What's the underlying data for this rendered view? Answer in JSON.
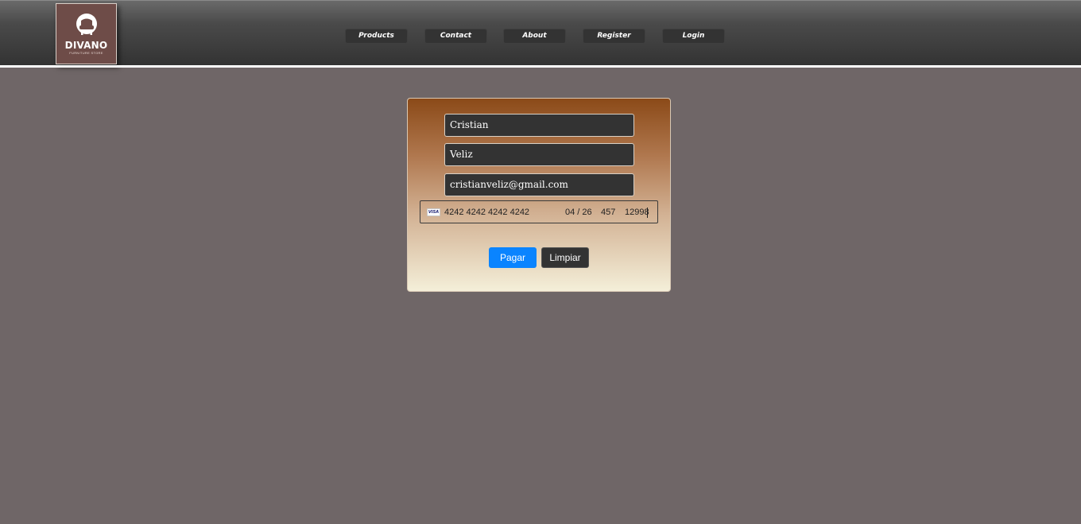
{
  "header": {
    "logo": {
      "name": "DIVANO",
      "tagline": "FURNITURE STORE",
      "icon": "armchair-icon"
    },
    "nav": [
      {
        "label": "Products"
      },
      {
        "label": "Contact"
      },
      {
        "label": "About"
      },
      {
        "label": "Register"
      },
      {
        "label": "Login"
      }
    ]
  },
  "form": {
    "first_name": "Cristian",
    "last_name": "Veliz",
    "email": "cristianveliz@gmail.com",
    "card": {
      "brand": "VISA",
      "number": "4242 4242 4242 4242",
      "expiry": "04 / 26",
      "cvc": "457",
      "zip": "12998"
    },
    "pay_label": "Pagar",
    "clear_label": "Limpiar"
  },
  "colors": {
    "page_bg": "#6f6667",
    "header_bg": "#333333",
    "logo_bg": "#6e4c48",
    "pay_button": "#0a84ff",
    "clear_button": "#333333",
    "input_bg": "#333333"
  }
}
